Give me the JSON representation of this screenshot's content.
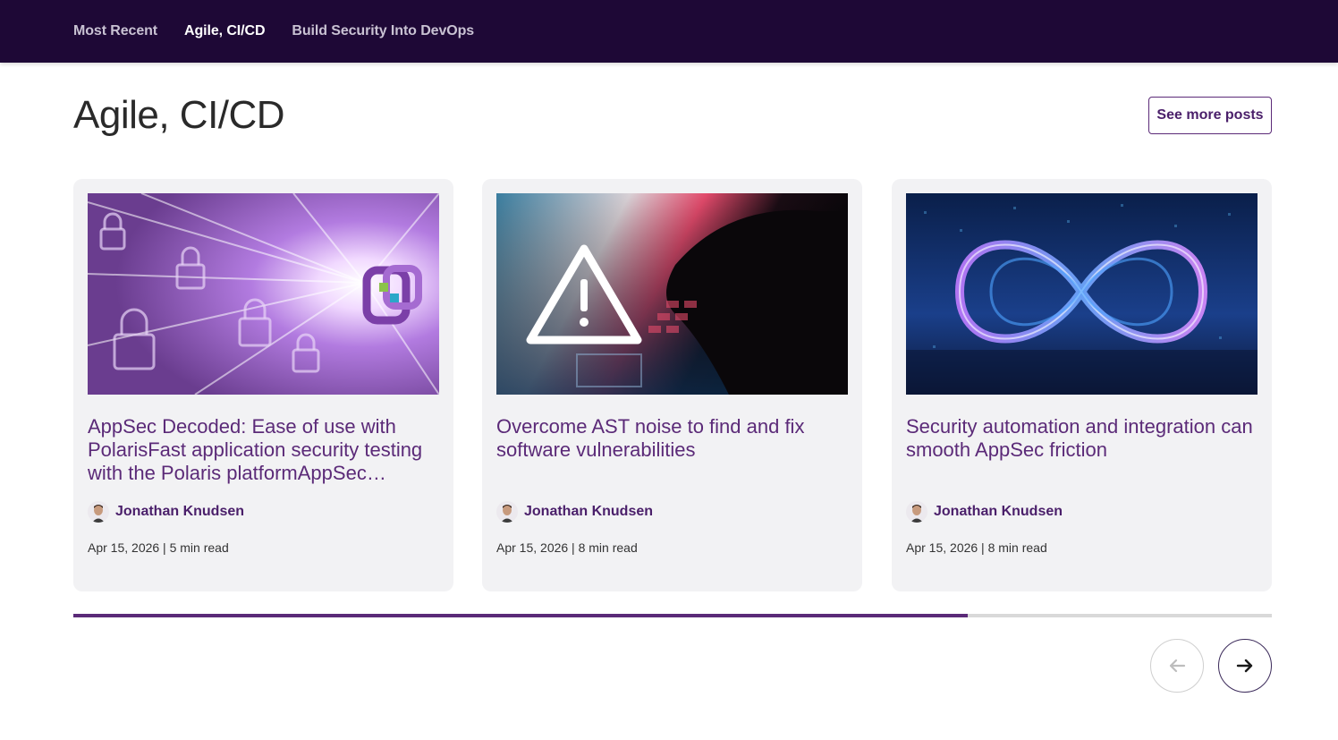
{
  "nav": {
    "tabs": [
      {
        "label": "Most Recent"
      },
      {
        "label": "Agile, CI/CD"
      },
      {
        "label": "Build Security Into DevOps"
      }
    ]
  },
  "section": {
    "title": "Agile, CI/CD",
    "see_more_label": "See more posts"
  },
  "cards": [
    {
      "title": "AppSec Decoded: Ease of use with PolarisFast application security testing with the Polaris platformAppSec…",
      "author": "Jonathan Knudsen",
      "meta": "Apr 15, 2026 | 5 min read"
    },
    {
      "title": "Overcome AST noise to find and fix software vulnerabilities",
      "author": "Jonathan Knudsen",
      "meta": "Apr 15, 2026 | 8 min read"
    },
    {
      "title": "Security automation and integration can smooth AppSec friction",
      "author": "Jonathan Knudsen",
      "meta": "Apr 15, 2026 | 8 min read"
    }
  ],
  "carousel": {
    "progress_fraction": 0.746,
    "prev_icon": "arrow-left-icon",
    "next_icon": "arrow-right-icon"
  },
  "colors": {
    "nav_bg": "#1e0836",
    "accent": "#5b2a78",
    "card_bg": "#f2f2f4"
  }
}
